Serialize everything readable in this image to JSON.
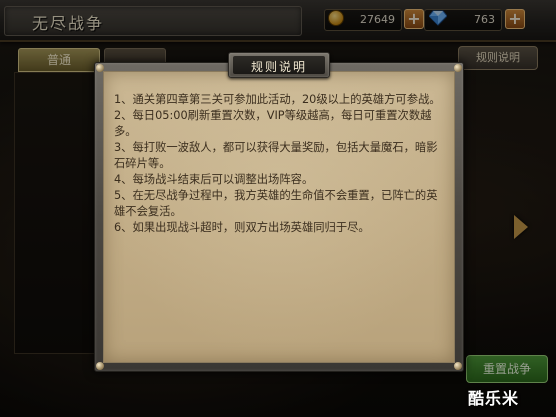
{
  "header": {
    "title": "无尽战争",
    "gold": {
      "icon": "gold-coin-icon",
      "value": "27649",
      "add_label": "+"
    },
    "gems": {
      "icon": "gem-icon",
      "value": "763",
      "add_label": "+"
    }
  },
  "tabs": [
    {
      "label": "普通",
      "active": true
    },
    {
      "label": "",
      "active": false
    }
  ],
  "rules_top_button": {
    "label": "规则说明"
  },
  "reset_battle_button": {
    "label": "重置战争"
  },
  "dialog": {
    "title": "规则说明",
    "rules": [
      "1、通关第四章第三关可参加此活动，20级以上的英雄方可参战。",
      "2、每日05:00刷新重置次数，VIP等级越高，每日可重置次数越多。",
      "3、每打败一波敌人，都可以获得大量奖励，包括大量魔石，暗影石碎片等。",
      "4、每场战斗结束后可以调整出场阵容。",
      "5、在无尽战争过程中，我方英雄的生命值不会重置，已阵亡的英雄不会复活。",
      "6、如果出现战斗超时，则双方出场英雄同归于尽。"
    ]
  },
  "watermark": "酷乐米",
  "colors": {
    "parchment": "#c2ad87",
    "rule_text": "#3b2e1e",
    "accent_orange": "#d08a3a",
    "button_green": "#4f9b3a"
  }
}
